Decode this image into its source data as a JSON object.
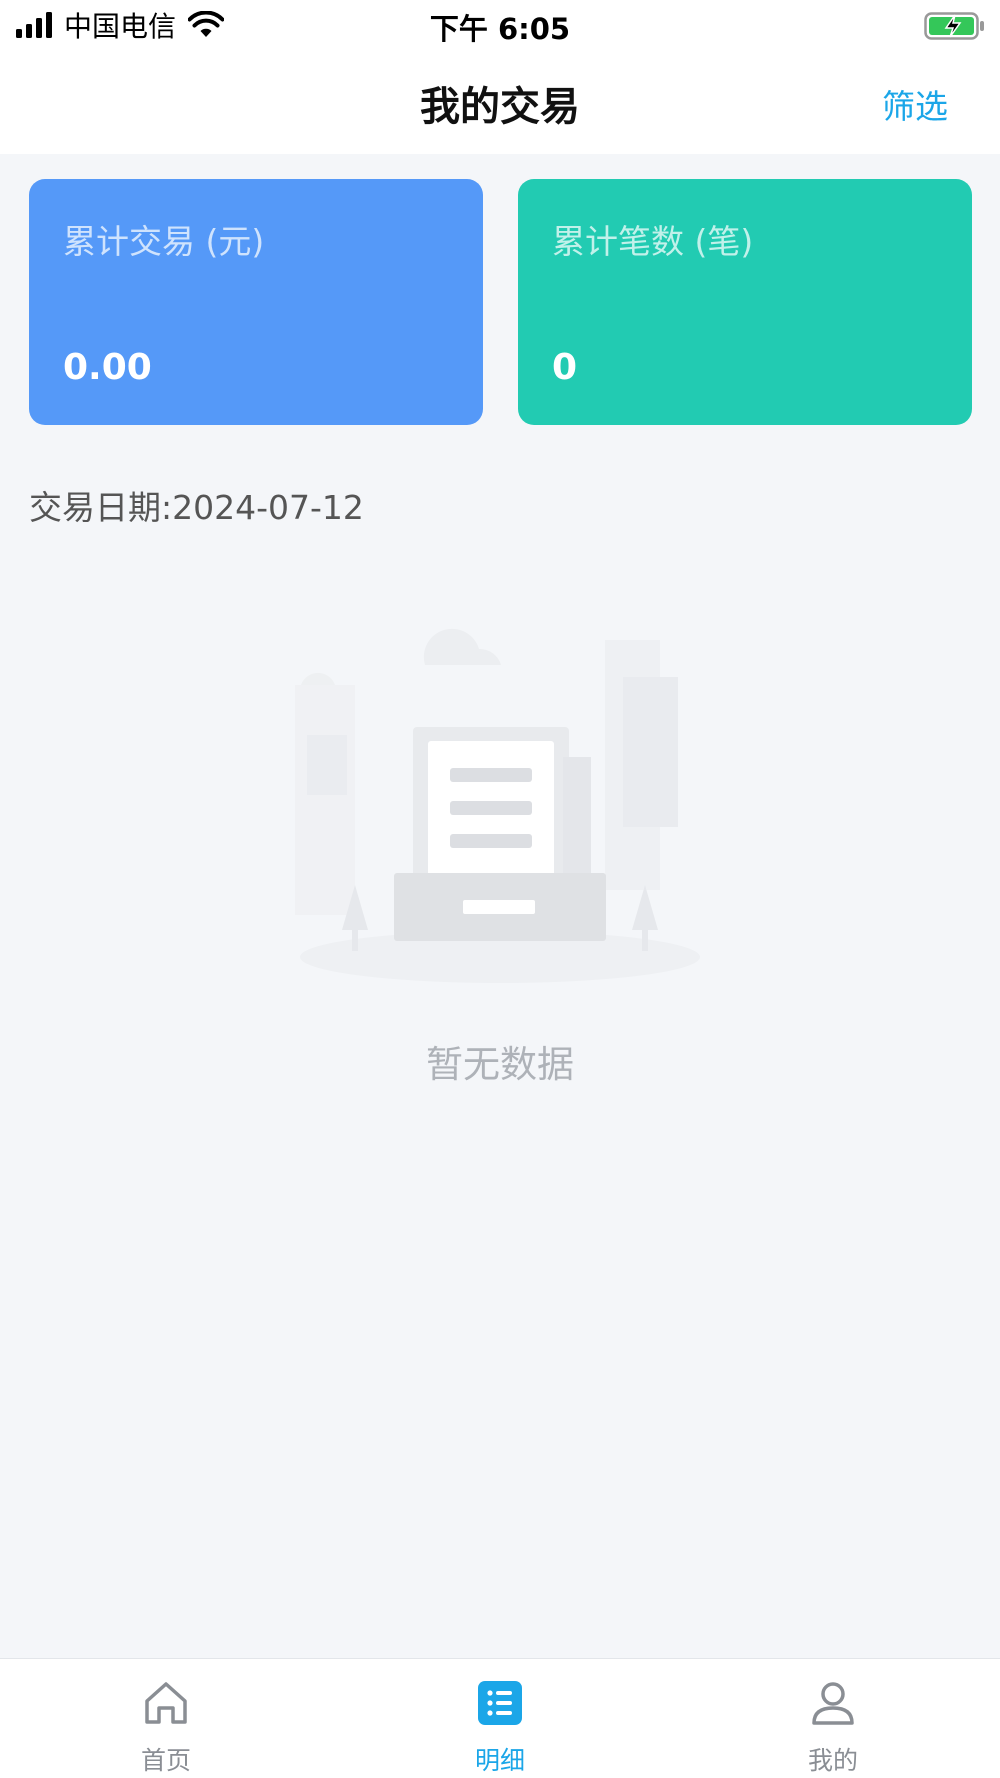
{
  "status_bar": {
    "carrier": "中国电信",
    "time": "下午 6:05"
  },
  "nav": {
    "title": "我的交易",
    "filter_label": "筛选"
  },
  "cards": [
    {
      "label": "累计交易 (元)",
      "value": "0.00",
      "color": "#5599f8"
    },
    {
      "label": "累计笔数 (笔)",
      "value": "0",
      "color": "#22cbb2"
    }
  ],
  "date_line": "交易日期:2024-07-12",
  "empty": {
    "message": "暂无数据"
  },
  "tabs": [
    {
      "label": "首页",
      "icon": "home-icon",
      "active": false
    },
    {
      "label": "明细",
      "icon": "list-icon",
      "active": true
    },
    {
      "label": "我的",
      "icon": "user-icon",
      "active": false
    }
  ],
  "colors": {
    "accent": "#1ba6e8",
    "background": "#f4f6f9"
  }
}
